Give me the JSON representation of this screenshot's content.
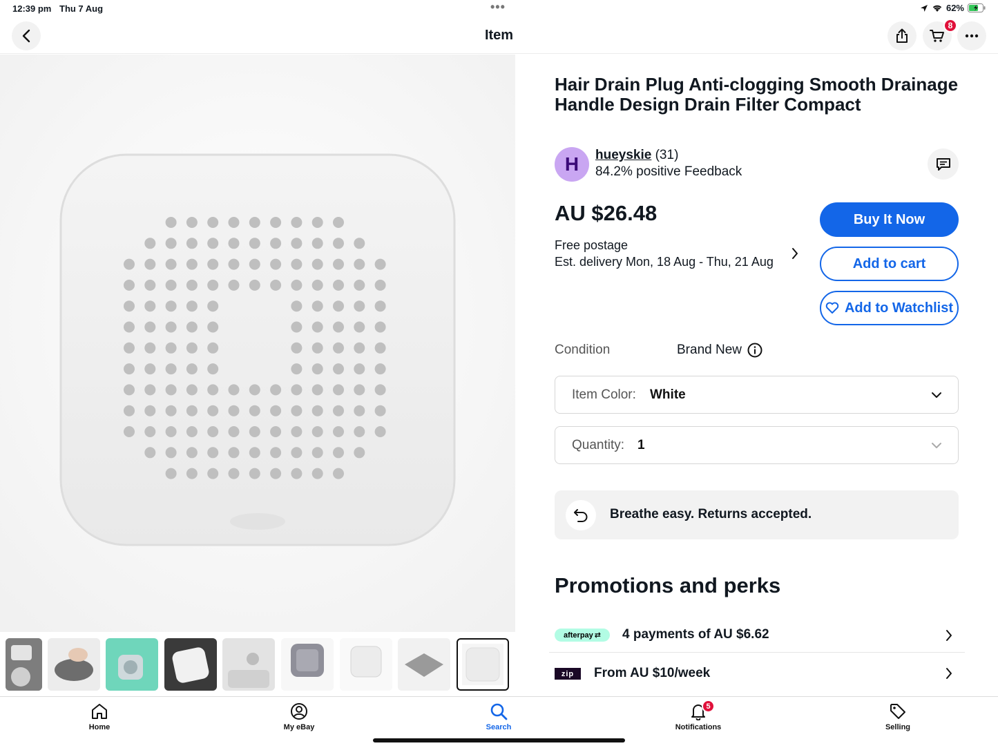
{
  "status_bar": {
    "time": "12:39 pm",
    "date": "Thu 7 Aug",
    "battery": "62%"
  },
  "nav": {
    "title": "Item",
    "cart_count": "8"
  },
  "product": {
    "title": "Hair Drain Plug Anti-clogging Smooth Drainage Handle Design Drain Filter Compact",
    "thumbnails_count": 9,
    "selected_thumbnail": 9
  },
  "seller": {
    "avatar_letter": "H",
    "name": "hueyskie",
    "score": "(31)",
    "feedback": "84.2% positive Feedback"
  },
  "price": {
    "amount": "AU $26.48",
    "shipping": "Free postage",
    "delivery": "Est. delivery Mon, 18 Aug - Thu, 21 Aug"
  },
  "actions": {
    "buy_now": "Buy It Now",
    "add_to_cart": "Add to cart",
    "add_to_watchlist": "Add to Watchlist"
  },
  "condition": {
    "label": "Condition",
    "value": "Brand New"
  },
  "variations": {
    "color_label": "Item Color:",
    "color_value": "White",
    "quantity_label": "Quantity:",
    "quantity_value": "1"
  },
  "returns": {
    "text": "Breathe easy. Returns accepted."
  },
  "promotions": {
    "heading": "Promotions and perks",
    "afterpay_logo": "afterpay",
    "afterpay_text": "4 payments of AU $6.62",
    "zip_logo": "zip",
    "zip_text": "From AU $10/week"
  },
  "tabbar": {
    "home": "Home",
    "my_ebay": "My eBay",
    "search": "Search",
    "notifications": "Notifications",
    "notifications_count": "5",
    "selling": "Selling"
  },
  "colors": {
    "accent": "#1366e8",
    "badge": "#e0103a",
    "afterpay": "#b2fce4"
  }
}
